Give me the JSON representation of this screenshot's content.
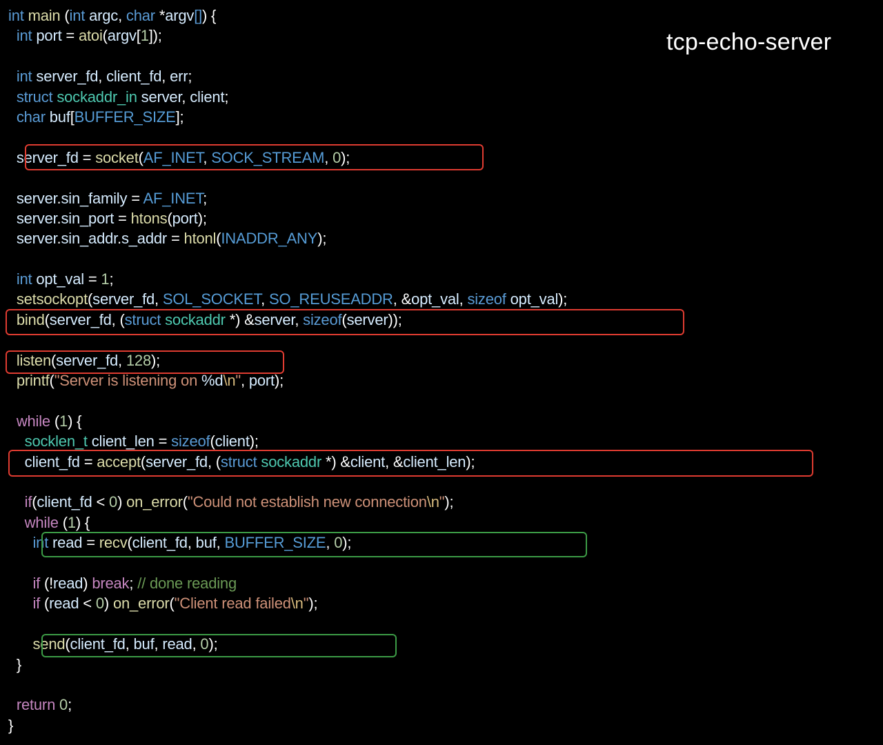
{
  "title": "tcp-echo-server",
  "colors": {
    "background": "#000000",
    "keyword": "#5a9bd5",
    "control": "#c586c0",
    "function": "#dcdcaa",
    "variable": "#d6ecff",
    "string": "#ce9178",
    "number": "#b5cea8",
    "comment": "#6a9955",
    "type": "#4ec9b0",
    "highlight_primary": "#e03c31",
    "highlight_secondary": "#3c9c46"
  },
  "code_lines": [
    [
      [
        "kw",
        "int "
      ],
      [
        "fn",
        "main"
      ],
      [
        "op",
        " ("
      ],
      [
        "kw",
        "int "
      ],
      [
        "var",
        "argc"
      ],
      [
        "op",
        ", "
      ],
      [
        "kw",
        "char "
      ],
      [
        "op",
        "*"
      ],
      [
        "var",
        "argv"
      ],
      [
        "kw",
        "[]"
      ],
      [
        "op",
        ") {"
      ]
    ],
    [
      [
        "op",
        "  "
      ],
      [
        "kw",
        "int "
      ],
      [
        "var",
        "port"
      ],
      [
        "op",
        " = "
      ],
      [
        "fn",
        "atoi"
      ],
      [
        "op",
        "("
      ],
      [
        "var",
        "argv"
      ],
      [
        "op",
        "["
      ],
      [
        "num",
        "1"
      ],
      [
        "op",
        "]);"
      ]
    ],
    [],
    [
      [
        "op",
        "  "
      ],
      [
        "kw",
        "int "
      ],
      [
        "var",
        "server_fd"
      ],
      [
        "op",
        ", "
      ],
      [
        "var",
        "client_fd"
      ],
      [
        "op",
        ", "
      ],
      [
        "var",
        "err"
      ],
      [
        "op",
        ";"
      ]
    ],
    [
      [
        "op",
        "  "
      ],
      [
        "kw",
        "struct "
      ],
      [
        "type",
        "sockaddr_in "
      ],
      [
        "var",
        "server"
      ],
      [
        "op",
        ", "
      ],
      [
        "var",
        "client"
      ],
      [
        "op",
        ";"
      ]
    ],
    [
      [
        "op",
        "  "
      ],
      [
        "kw",
        "char "
      ],
      [
        "var",
        "buf"
      ],
      [
        "op",
        "["
      ],
      [
        "mac",
        "BUFFER_SIZE"
      ],
      [
        "op",
        "];"
      ]
    ],
    [],
    [
      [
        "op",
        "  "
      ],
      [
        "var",
        "server_fd"
      ],
      [
        "op",
        " = "
      ],
      [
        "fn",
        "socket"
      ],
      [
        "op",
        "("
      ],
      [
        "mac",
        "AF_INET"
      ],
      [
        "op",
        ", "
      ],
      [
        "mac",
        "SOCK_STREAM"
      ],
      [
        "op",
        ", "
      ],
      [
        "num",
        "0"
      ],
      [
        "op",
        ");"
      ]
    ],
    [],
    [
      [
        "op",
        "  "
      ],
      [
        "var",
        "server"
      ],
      [
        "op",
        "."
      ],
      [
        "var",
        "sin_family"
      ],
      [
        "op",
        " = "
      ],
      [
        "mac",
        "AF_INET"
      ],
      [
        "op",
        ";"
      ]
    ],
    [
      [
        "op",
        "  "
      ],
      [
        "var",
        "server"
      ],
      [
        "op",
        "."
      ],
      [
        "var",
        "sin_port"
      ],
      [
        "op",
        " = "
      ],
      [
        "fn",
        "htons"
      ],
      [
        "op",
        "("
      ],
      [
        "var",
        "port"
      ],
      [
        "op",
        ");"
      ]
    ],
    [
      [
        "op",
        "  "
      ],
      [
        "var",
        "server"
      ],
      [
        "op",
        "."
      ],
      [
        "var",
        "sin_addr"
      ],
      [
        "op",
        "."
      ],
      [
        "var",
        "s_addr"
      ],
      [
        "op",
        " = "
      ],
      [
        "fn",
        "htonl"
      ],
      [
        "op",
        "("
      ],
      [
        "mac",
        "INADDR_ANY"
      ],
      [
        "op",
        ");"
      ]
    ],
    [],
    [
      [
        "op",
        "  "
      ],
      [
        "kw",
        "int "
      ],
      [
        "var",
        "opt_val"
      ],
      [
        "op",
        " = "
      ],
      [
        "num",
        "1"
      ],
      [
        "op",
        ";"
      ]
    ],
    [
      [
        "op",
        "  "
      ],
      [
        "fn",
        "setsockopt"
      ],
      [
        "op",
        "("
      ],
      [
        "var",
        "server_fd"
      ],
      [
        "op",
        ", "
      ],
      [
        "mac",
        "SOL_SOCKET"
      ],
      [
        "op",
        ", "
      ],
      [
        "mac",
        "SO_REUSEADDR"
      ],
      [
        "op",
        ", &"
      ],
      [
        "var",
        "opt_val"
      ],
      [
        "op",
        ", "
      ],
      [
        "kw",
        "sizeof "
      ],
      [
        "var",
        "opt_val"
      ],
      [
        "op",
        ");"
      ]
    ],
    [
      [
        "op",
        "  "
      ],
      [
        "fn",
        "bind"
      ],
      [
        "op",
        "("
      ],
      [
        "var",
        "server_fd"
      ],
      [
        "op",
        ", ("
      ],
      [
        "kw",
        "struct "
      ],
      [
        "type",
        "sockaddr "
      ],
      [
        "op",
        "*) &"
      ],
      [
        "var",
        "server"
      ],
      [
        "op",
        ", "
      ],
      [
        "kw",
        "sizeof"
      ],
      [
        "op",
        "("
      ],
      [
        "var",
        "server"
      ],
      [
        "op",
        "));"
      ]
    ],
    [],
    [
      [
        "op",
        "  "
      ],
      [
        "fn",
        "listen"
      ],
      [
        "op",
        "("
      ],
      [
        "var",
        "server_fd"
      ],
      [
        "op",
        ", "
      ],
      [
        "num",
        "128"
      ],
      [
        "op",
        ");"
      ]
    ],
    [
      [
        "op",
        "  "
      ],
      [
        "fn",
        "printf"
      ],
      [
        "op",
        "("
      ],
      [
        "str",
        "\"Server is listening on "
      ],
      [
        "var",
        "%d"
      ],
      [
        "esc",
        "\\n"
      ],
      [
        "str",
        "\""
      ],
      [
        "op",
        ", "
      ],
      [
        "var",
        "port"
      ],
      [
        "op",
        ");"
      ]
    ],
    [],
    [
      [
        "op",
        "  "
      ],
      [
        "ctl",
        "while "
      ],
      [
        "op",
        "("
      ],
      [
        "num",
        "1"
      ],
      [
        "op",
        ") {"
      ]
    ],
    [
      [
        "op",
        "    "
      ],
      [
        "type",
        "socklen_t "
      ],
      [
        "var",
        "client_len"
      ],
      [
        "op",
        " = "
      ],
      [
        "kw",
        "sizeof"
      ],
      [
        "op",
        "("
      ],
      [
        "var",
        "client"
      ],
      [
        "op",
        ");"
      ]
    ],
    [
      [
        "op",
        "    "
      ],
      [
        "var",
        "client_fd"
      ],
      [
        "op",
        " = "
      ],
      [
        "fn",
        "accept"
      ],
      [
        "op",
        "("
      ],
      [
        "var",
        "server_fd"
      ],
      [
        "op",
        ", ("
      ],
      [
        "kw",
        "struct "
      ],
      [
        "type",
        "sockaddr "
      ],
      [
        "op",
        "*) &"
      ],
      [
        "var",
        "client"
      ],
      [
        "op",
        ", &"
      ],
      [
        "var",
        "client_len"
      ],
      [
        "op",
        ");"
      ]
    ],
    [],
    [
      [
        "op",
        "    "
      ],
      [
        "ctl",
        "if"
      ],
      [
        "op",
        "("
      ],
      [
        "var",
        "client_fd"
      ],
      [
        "op",
        " < "
      ],
      [
        "num",
        "0"
      ],
      [
        "op",
        ") "
      ],
      [
        "fn",
        "on_error"
      ],
      [
        "op",
        "("
      ],
      [
        "str",
        "\"Could not establish new connection"
      ],
      [
        "esc",
        "\\n"
      ],
      [
        "str",
        "\""
      ],
      [
        "op",
        ");"
      ]
    ],
    [
      [
        "op",
        "    "
      ],
      [
        "ctl",
        "while "
      ],
      [
        "op",
        "("
      ],
      [
        "num",
        "1"
      ],
      [
        "op",
        ") {"
      ]
    ],
    [
      [
        "op",
        "      "
      ],
      [
        "kw",
        "int "
      ],
      [
        "var",
        "read"
      ],
      [
        "op",
        " = "
      ],
      [
        "fn",
        "recv"
      ],
      [
        "op",
        "("
      ],
      [
        "var",
        "client_fd"
      ],
      [
        "op",
        ", "
      ],
      [
        "var",
        "buf"
      ],
      [
        "op",
        ", "
      ],
      [
        "mac",
        "BUFFER_SIZE"
      ],
      [
        "op",
        ", "
      ],
      [
        "num",
        "0"
      ],
      [
        "op",
        ");"
      ]
    ],
    [],
    [
      [
        "op",
        "      "
      ],
      [
        "ctl",
        "if "
      ],
      [
        "op",
        "(!"
      ],
      [
        "var",
        "read"
      ],
      [
        "op",
        ") "
      ],
      [
        "ctl",
        "break"
      ],
      [
        "op",
        "; "
      ],
      [
        "cmt",
        "// done reading"
      ]
    ],
    [
      [
        "op",
        "      "
      ],
      [
        "ctl",
        "if "
      ],
      [
        "op",
        "("
      ],
      [
        "var",
        "read"
      ],
      [
        "op",
        " < "
      ],
      [
        "num",
        "0"
      ],
      [
        "op",
        ") "
      ],
      [
        "fn",
        "on_error"
      ],
      [
        "op",
        "("
      ],
      [
        "str",
        "\"Client read failed"
      ],
      [
        "esc",
        "\\n"
      ],
      [
        "str",
        "\""
      ],
      [
        "op",
        ");"
      ]
    ],
    [],
    [
      [
        "op",
        "      "
      ],
      [
        "fn",
        "send"
      ],
      [
        "op",
        "("
      ],
      [
        "var",
        "client_fd"
      ],
      [
        "op",
        ", "
      ],
      [
        "var",
        "buf"
      ],
      [
        "op",
        ", "
      ],
      [
        "var",
        "read"
      ],
      [
        "op",
        ", "
      ],
      [
        "num",
        "0"
      ],
      [
        "op",
        ");"
      ]
    ],
    [
      [
        "op",
        "  }"
      ]
    ],
    [],
    [
      [
        "op",
        "  "
      ],
      [
        "ctl",
        "return "
      ],
      [
        "num",
        "0"
      ],
      [
        "op",
        ";"
      ]
    ],
    [
      [
        "op",
        "}"
      ]
    ]
  ]
}
